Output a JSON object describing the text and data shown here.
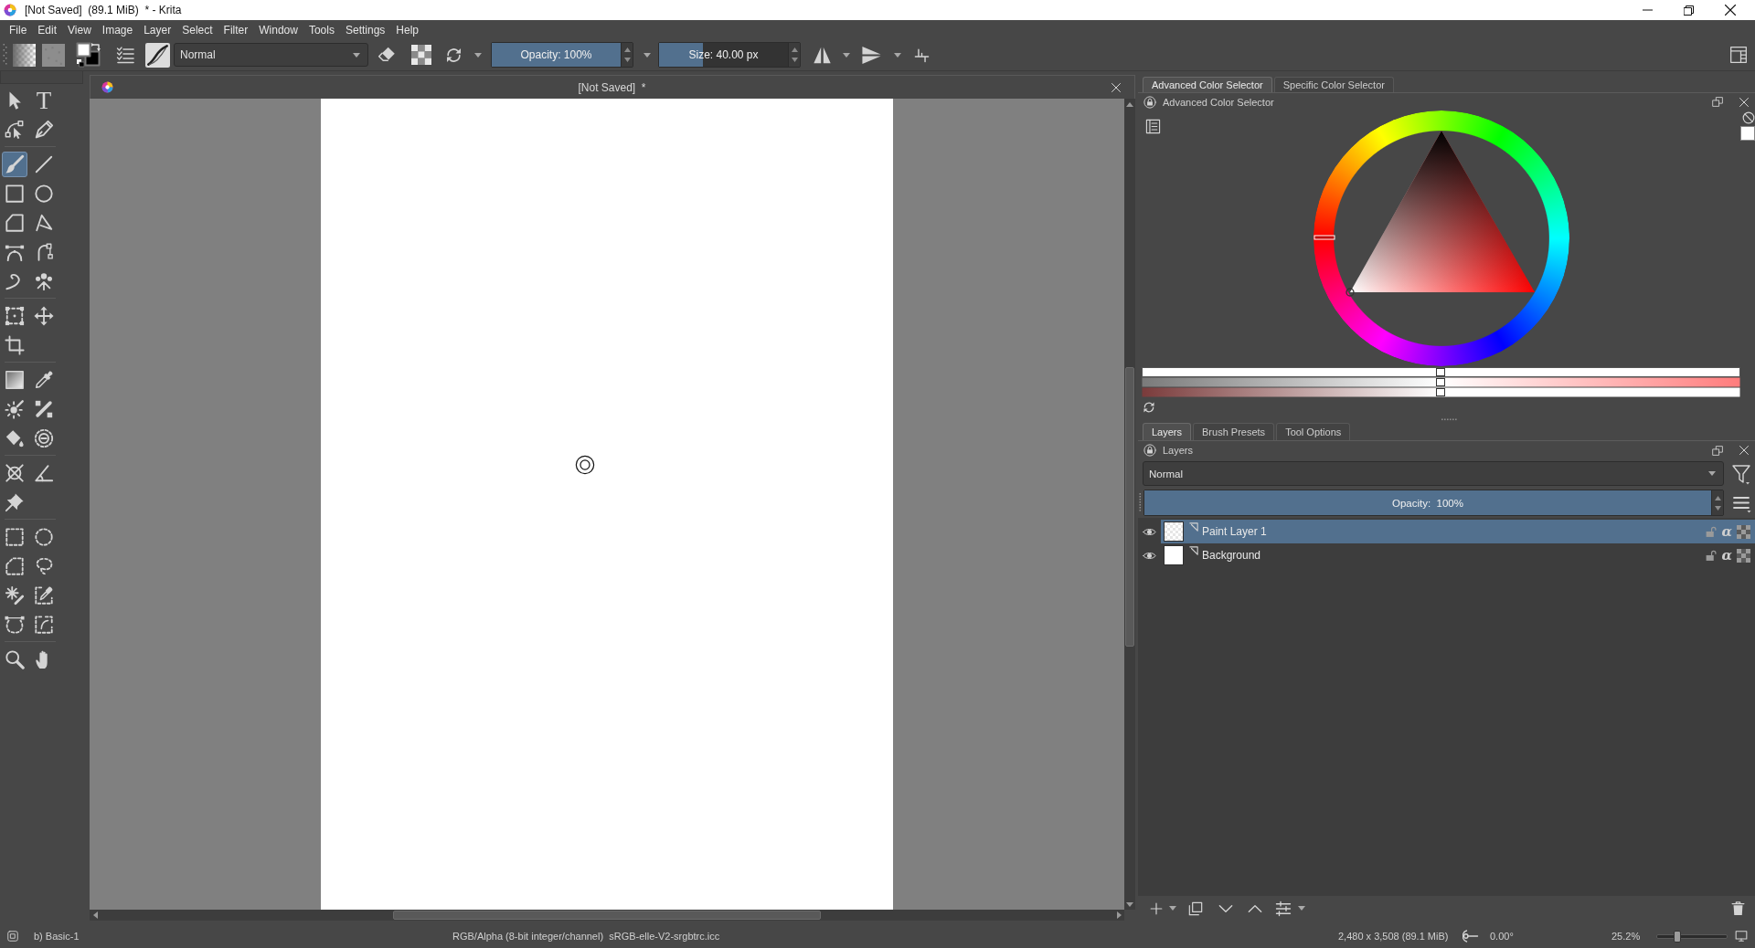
{
  "window": {
    "title": "[Not Saved]  (89.1 MiB)  * - Krita"
  },
  "menu_bar": [
    "File",
    "Edit",
    "View",
    "Image",
    "Layer",
    "Select",
    "Filter",
    "Window",
    "Tools",
    "Settings",
    "Help"
  ],
  "toolbar": {
    "blend_mode": "Normal",
    "opacity": {
      "reading": "Opacity: 100%",
      "level": 1
    },
    "size": {
      "reading": "Size: 40.00 px",
      "level": 0.34
    }
  },
  "toolbox": {
    "groups": [
      {
        "tools": [
          {
            "selected": false
          },
          {
            "selected": false,
            "glyph": "T"
          },
          {
            "selected": false
          },
          {
            "selected": false
          }
        ]
      },
      {
        "tools": [
          {
            "selected": true
          },
          {
            "selected": false
          },
          {
            "selected": false
          },
          {
            "selected": false
          },
          {
            "selected": false
          },
          {
            "selected": false
          },
          {
            "selected": false
          },
          {
            "selected": false
          },
          {
            "selected": false
          },
          {
            "selected": false
          }
        ]
      },
      {
        "tools": [
          {
            "selected": false
          },
          {
            "selected": false
          },
          {
            "selected": false
          }
        ]
      },
      {
        "tools": [
          {
            "selected": false
          },
          {
            "selected": false
          },
          {
            "selected": false
          },
          {
            "selected": false
          },
          {
            "selected": false
          },
          {
            "selected": false
          }
        ]
      },
      {
        "tools": [
          {
            "selected": false
          },
          {
            "selected": false
          },
          {
            "selected": false
          }
        ]
      },
      {
        "tools": [
          {
            "selected": false
          },
          {
            "selected": false
          },
          {
            "selected": false
          },
          {
            "selected": false
          },
          {
            "selected": false
          },
          {
            "selected": false
          },
          {
            "selected": false
          },
          {
            "selected": false
          }
        ]
      },
      {
        "tools": [
          {
            "selected": false
          },
          {
            "selected": false
          }
        ]
      }
    ]
  },
  "document": {
    "tab_title": "[Not Saved]  *"
  },
  "color_docker": {
    "tabs": [
      {
        "label": "Advanced Color Selector",
        "selected": true
      },
      {
        "label": "Specific Color Selector",
        "selected": false
      }
    ],
    "title": "Advanced Color Selector"
  },
  "layers_docker": {
    "tabs": [
      {
        "label": "Layers",
        "selected": true
      },
      {
        "label": "Brush Presets",
        "selected": false
      },
      {
        "label": "Tool Options",
        "selected": false
      }
    ],
    "title": "Layers",
    "blend_mode": "Normal",
    "opacity": {
      "reading": "Opacity:  100%",
      "level": 1
    },
    "layers": [
      {
        "name": "Paint Layer 1",
        "selected": true,
        "visible": true,
        "transparent": true,
        "toggles": [
          {
            "kind": "lock",
            "on": false
          },
          {
            "kind": "alpha",
            "glyph": "α",
            "on": false
          },
          {
            "kind": "inherit_alpha",
            "on": false
          }
        ]
      },
      {
        "name": "Background",
        "selected": false,
        "visible": true,
        "transparent": false,
        "toggles": [
          {
            "kind": "lock",
            "on": false
          },
          {
            "kind": "alpha",
            "glyph": "α",
            "on": false
          },
          {
            "kind": "inherit_alpha",
            "on": false
          }
        ]
      }
    ]
  },
  "status_bar": {
    "brush_preset": "b) Basic-1",
    "color_space": "RGB/Alpha (8-bit integer/channel)  sRGB-elle-V2-srgbtrc.icc",
    "image_size": "2,480 x 3,508 (89.1 MiB)",
    "rotation": "0.00°",
    "zoom": {
      "reading": "25.2%",
      "level": 0.29
    }
  }
}
